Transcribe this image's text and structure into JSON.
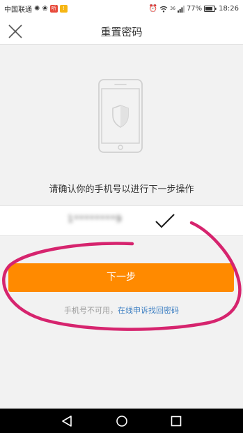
{
  "status_bar": {
    "carrier": "中国联通",
    "badge_1": "听",
    "badge_2": "!",
    "signal_type": "36",
    "battery": "77%",
    "time": "18:26",
    "colors": {
      "badge_1": "#e84a3c",
      "badge_2": "#f6b614"
    }
  },
  "header": {
    "title": "重置密码",
    "close_icon": "close-icon"
  },
  "illustration": {
    "icon": "phone-shield-icon"
  },
  "instruction": "请确认你的手机号以进行下一步操作",
  "phone": {
    "value": "1********9",
    "selected_icon": "checkmark-icon"
  },
  "actions": {
    "next_label": "下一步",
    "help_text": "手机号不可用，",
    "help_link": "在线申诉找回密码"
  },
  "system_nav": {
    "back_icon": "back-triangle-icon",
    "home_icon": "home-circle-icon",
    "recents_icon": "recents-square-icon"
  },
  "colors": {
    "accent": "#ff8a00",
    "link": "#3d7fc2",
    "annotation": "#d6246e",
    "background": "#f2f2f2"
  }
}
